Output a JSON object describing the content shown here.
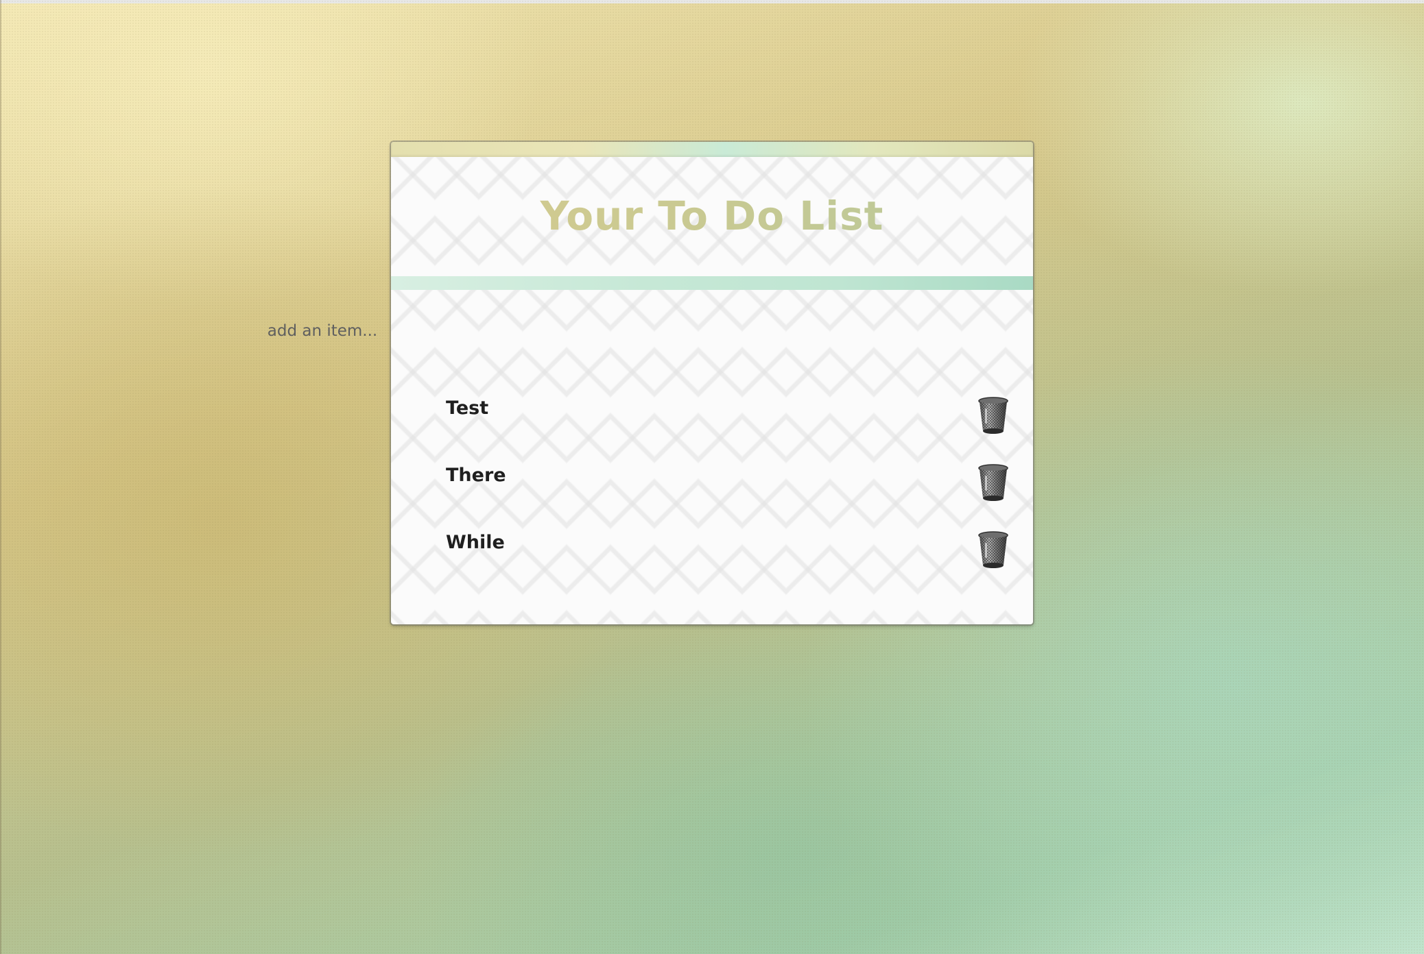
{
  "page": {
    "title": "Your To Do List",
    "add_placeholder": "add an item..."
  },
  "todo_items": [
    {
      "label": "Test"
    },
    {
      "label": "There"
    },
    {
      "label": "While"
    }
  ],
  "icons": {
    "delete": "trash-icon"
  },
  "colors": {
    "title": "#c9c98e",
    "item_text": "#1f1f1f",
    "accent_mint": "#bfe5d2",
    "accent_gold": "#e4dfae"
  }
}
